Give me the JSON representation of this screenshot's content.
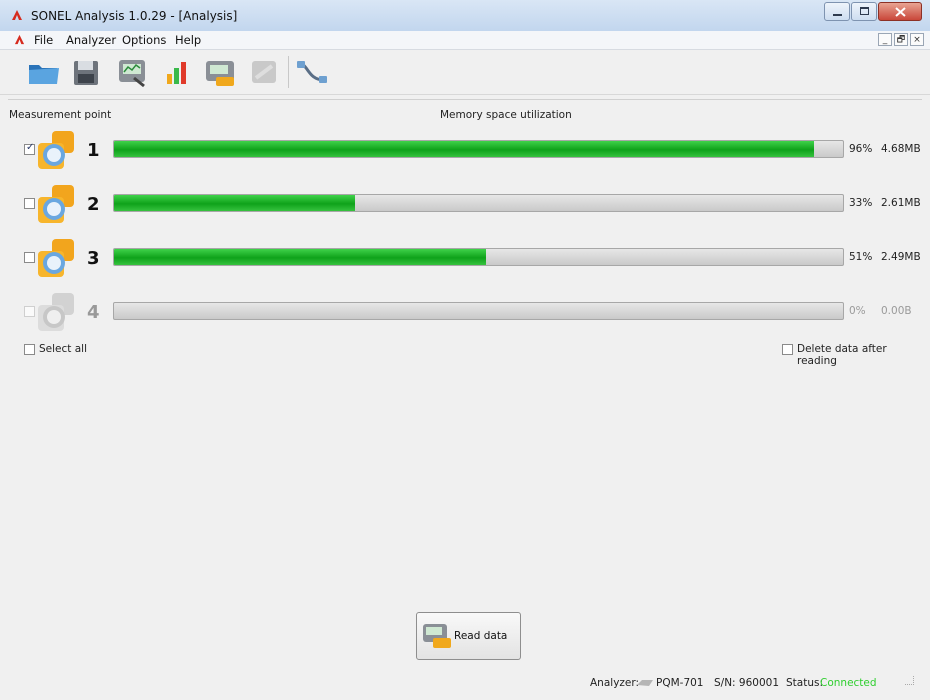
{
  "window": {
    "title": "SONEL Analysis 1.0.29 - [Analysis]"
  },
  "menu": {
    "items": [
      "File",
      "Analyzer",
      "Options",
      "Help"
    ],
    "mdi": {
      "minimize": "_",
      "restore": "🗗",
      "close": "×"
    }
  },
  "toolbar": {
    "buttons": [
      {
        "icon": "open-folder-icon",
        "enabled": true
      },
      {
        "icon": "save-floppy-icon",
        "enabled": true
      },
      {
        "icon": "analyzer-settings-icon",
        "enabled": true
      },
      {
        "icon": "bar-chart-icon",
        "enabled": true
      },
      {
        "icon": "read-analyzer-icon",
        "enabled": true
      },
      {
        "icon": "disabled-tool-icon",
        "enabled": false
      },
      {
        "icon": "connection-cable-icon",
        "enabled": true
      }
    ]
  },
  "headers": {
    "measurement_point": "Measurement point",
    "memory": "Memory space utilization"
  },
  "points": [
    {
      "number": "1",
      "checked": true,
      "enabled": true,
      "percent_text": "96%",
      "fill": 0.96,
      "size": "4.68MB"
    },
    {
      "number": "2",
      "checked": false,
      "enabled": true,
      "percent_text": "33%",
      "fill": 0.33,
      "size": "2.61MB"
    },
    {
      "number": "3",
      "checked": false,
      "enabled": true,
      "percent_text": "51%",
      "fill": 0.51,
      "size": "2.49MB"
    },
    {
      "number": "4",
      "checked": false,
      "enabled": false,
      "percent_text": "0%",
      "fill": 0.0,
      "size": "0.00B"
    }
  ],
  "options": {
    "select_all": "Select all",
    "delete_after": "Delete data after reading"
  },
  "read_button": {
    "label": "Read data"
  },
  "status": {
    "analyzer_label": "Analyzer:",
    "model": "PQM-701",
    "serial": "S/N: 960001",
    "status_label": "Status:",
    "status_value": "Connected"
  },
  "colors": {
    "progress_green": "#0fa21a",
    "connected_green": "#2fcf2f"
  }
}
